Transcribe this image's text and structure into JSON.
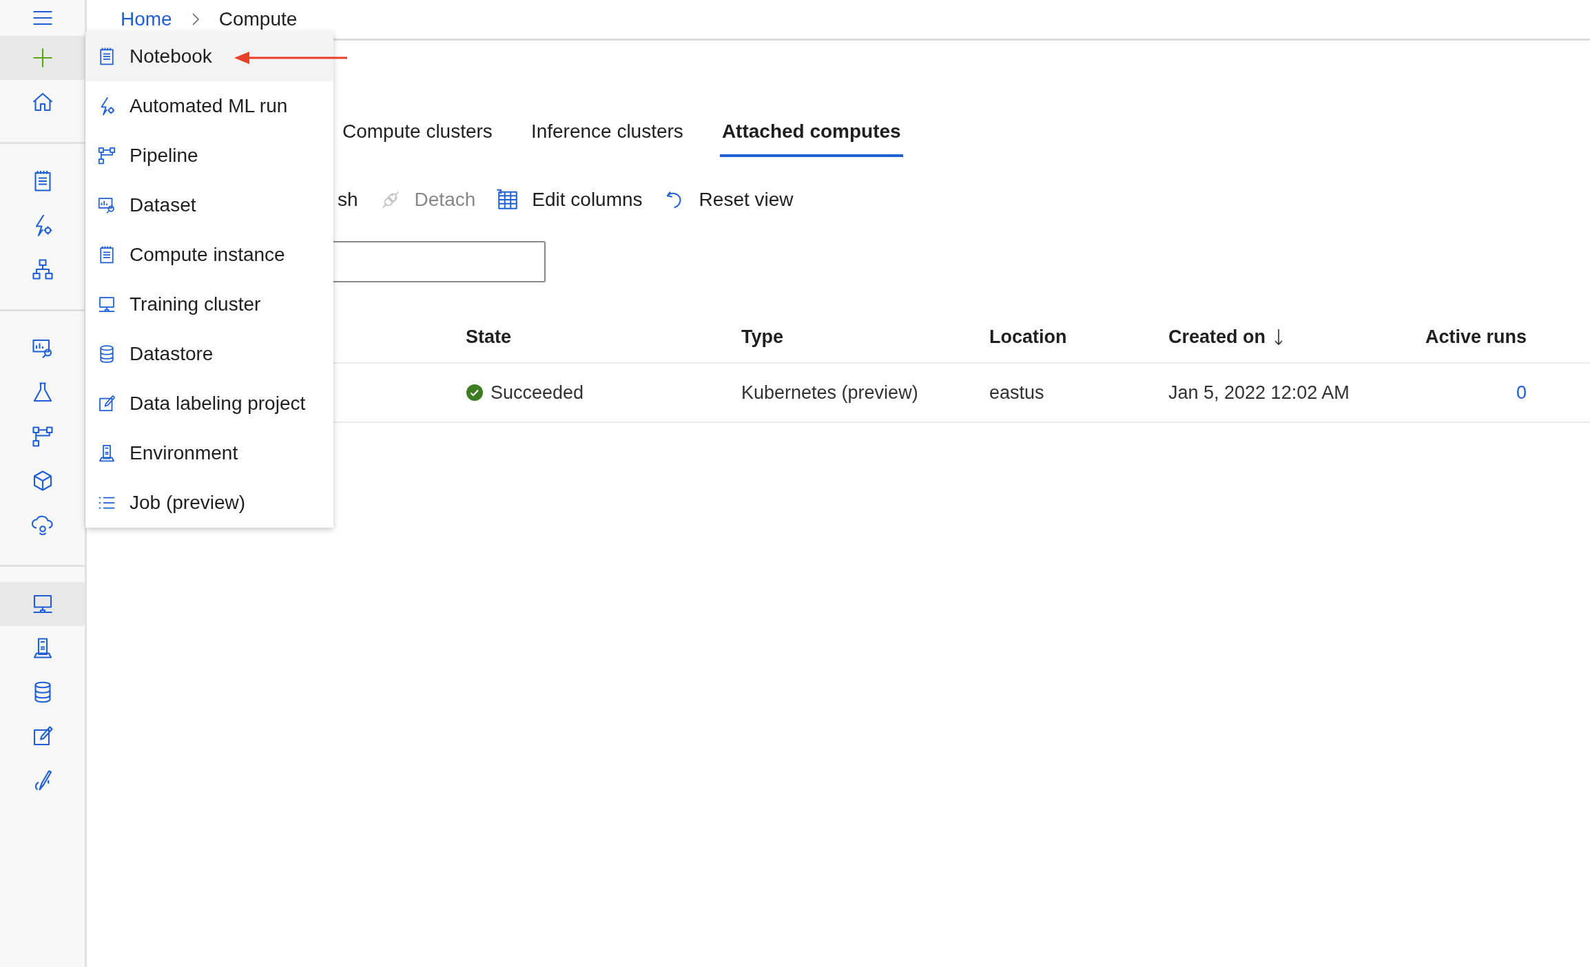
{
  "sidebar": {
    "groups": [
      [
        {
          "selected": false
        },
        {
          "selected": true
        },
        {
          "selected": false
        }
      ],
      [
        {
          "selected": false
        },
        {
          "selected": false
        },
        {
          "selected": false
        }
      ],
      [
        {
          "selected": false
        },
        {
          "selected": false
        },
        {
          "selected": false
        },
        {
          "selected": false
        },
        {
          "selected": false
        }
      ],
      [
        {
          "selected": true
        },
        {
          "selected": false
        },
        {
          "selected": false
        },
        {
          "selected": false
        },
        {
          "selected": false
        }
      ]
    ]
  },
  "breadcrumb": [
    {
      "label": "Home",
      "kind": "link"
    },
    {
      "label": "Compute",
      "kind": "current"
    }
  ],
  "tabs": [
    {
      "label": "Compute clusters",
      "selected": false
    },
    {
      "label": "Inference clusters",
      "selected": false
    },
    {
      "label": "Attached computes",
      "selected": true
    }
  ],
  "toolbar": [
    {
      "label": "sh",
      "disabled": false
    },
    {
      "label": "Detach",
      "disabled": true
    },
    {
      "label": "Edit columns",
      "disabled": false
    },
    {
      "label": "Reset view",
      "disabled": false
    }
  ],
  "table": {
    "columns": [
      {
        "label": "State",
        "sort_descending": false
      },
      {
        "label": "Type",
        "sort_descending": false
      },
      {
        "label": "Location",
        "sort_descending": false
      },
      {
        "label": "Created on",
        "sort_descending": true
      },
      {
        "label": "Active runs",
        "sort_descending": false
      }
    ],
    "rows": [
      {
        "state": "Succeeded",
        "succeeded": true,
        "type": "Kubernetes (preview)",
        "location": "eastus",
        "created_on": "Jan 5, 2022 12:02 AM",
        "active_runs": "0"
      }
    ]
  },
  "create_menu": {
    "items": [
      {
        "label": "Notebook",
        "selected": true
      },
      {
        "label": "Automated ML run",
        "selected": false
      },
      {
        "label": "Pipeline",
        "selected": false
      },
      {
        "label": "Dataset",
        "selected": false
      },
      {
        "label": "Compute instance",
        "selected": false
      },
      {
        "label": "Training cluster",
        "selected": false
      },
      {
        "label": "Datastore",
        "selected": false
      },
      {
        "label": "Data labeling project",
        "selected": false
      },
      {
        "label": "Environment",
        "selected": false
      },
      {
        "label": "Job (preview)",
        "selected": false
      }
    ]
  },
  "annotations": [
    {
      "kind": "arrow",
      "color": "#e8412b"
    }
  ]
}
